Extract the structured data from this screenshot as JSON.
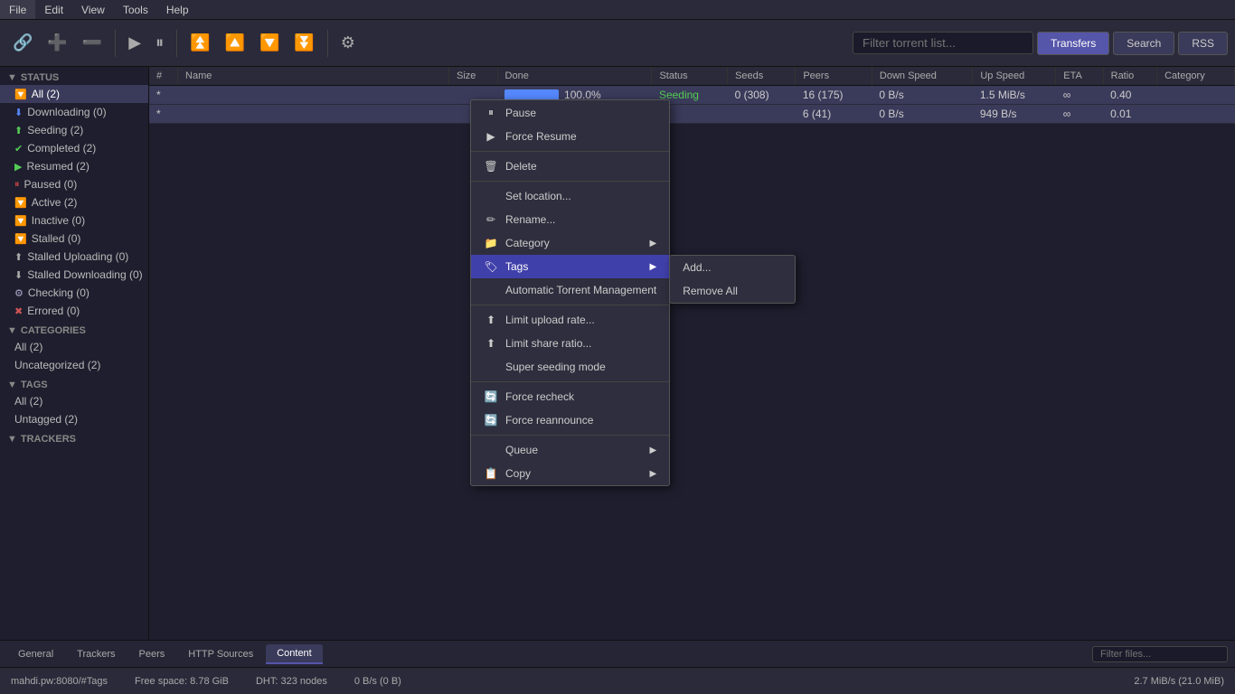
{
  "menubar": {
    "items": [
      "File",
      "Edit",
      "View",
      "Tools",
      "Help"
    ]
  },
  "toolbar": {
    "buttons": [
      {
        "name": "link-icon",
        "icon": "🔗"
      },
      {
        "name": "add-icon",
        "icon": "➕"
      },
      {
        "name": "remove-icon",
        "icon": "➖"
      },
      {
        "name": "resume-icon",
        "icon": "▶"
      },
      {
        "name": "pause-icon",
        "icon": "⏸"
      },
      {
        "name": "top-icon",
        "icon": "⏫"
      },
      {
        "name": "up-icon",
        "icon": "🔼"
      },
      {
        "name": "down-icon",
        "icon": "🔽"
      },
      {
        "name": "bottom-icon",
        "icon": "⏬"
      },
      {
        "name": "settings-icon",
        "icon": "⚙"
      }
    ],
    "filter_placeholder": "Filter torrent list...",
    "tabs": [
      "Transfers",
      "Search",
      "RSS"
    ]
  },
  "sidebar": {
    "status_header": "STATUS",
    "status_items": [
      {
        "label": "All (2)",
        "icon": "🔽",
        "active": true
      },
      {
        "label": "Downloading (0)",
        "icon": "⬇"
      },
      {
        "label": "Seeding (2)",
        "icon": "⬆"
      },
      {
        "label": "Completed (2)",
        "icon": "✔"
      },
      {
        "label": "Resumed (2)",
        "icon": "▶"
      },
      {
        "label": "Paused (0)",
        "icon": "⏸"
      },
      {
        "label": "Active (2)",
        "icon": "🔽"
      },
      {
        "label": "Inactive (0)",
        "icon": "🔽"
      },
      {
        "label": "Stalled (0)",
        "icon": "🔽"
      },
      {
        "label": "Stalled Uploading (0)",
        "icon": "⬆"
      },
      {
        "label": "Stalled Downloading (0)",
        "icon": "⬇"
      },
      {
        "label": "Checking (0)",
        "icon": "⚙"
      },
      {
        "label": "Errored (0)",
        "icon": "✖"
      }
    ],
    "categories_header": "CATEGORIES",
    "categories_items": [
      {
        "label": "All (2)"
      },
      {
        "label": "Uncategorized (2)"
      }
    ],
    "tags_header": "TAGS",
    "tags_items": [
      {
        "label": "All (2)"
      },
      {
        "label": "Untagged (2)"
      }
    ],
    "trackers_header": "TRACKERS"
  },
  "table": {
    "columns": [
      "#",
      "Name",
      "Size",
      "Done",
      "Status",
      "Seeds",
      "Peers",
      "Down Speed",
      "Up Speed",
      "ETA",
      "Ratio",
      "Category"
    ],
    "rows": [
      {
        "num": "*",
        "name": "",
        "size": "",
        "done": 100.0,
        "done_pct": "100.0%",
        "status": "Seeding",
        "seeds": "0 (308)",
        "peers": "16 (175)",
        "down_speed": "0 B/s",
        "up_speed": "1.5 MiB/s",
        "eta": "∞",
        "ratio": "0.40",
        "category": ""
      },
      {
        "num": "*",
        "name": "",
        "size": "",
        "done": 0,
        "done_pct": "",
        "status": "",
        "seeds": "",
        "peers": "6 (41)",
        "down_speed": "0 B/s",
        "up_speed": "949 B/s",
        "eta": "∞",
        "ratio": "0.01",
        "category": ""
      }
    ]
  },
  "context_menu": {
    "items": [
      {
        "id": "pause",
        "label": "Pause",
        "icon": "⏸",
        "has_sub": false
      },
      {
        "id": "force-resume",
        "label": "Force Resume",
        "icon": "▶",
        "has_sub": false
      },
      {
        "id": "sep1",
        "type": "sep"
      },
      {
        "id": "delete",
        "label": "Delete",
        "icon": "🗑",
        "has_sub": false
      },
      {
        "id": "sep2",
        "type": "sep"
      },
      {
        "id": "set-location",
        "label": "Set location...",
        "icon": "",
        "has_sub": false
      },
      {
        "id": "rename",
        "label": "Rename...",
        "icon": "✏",
        "has_sub": false
      },
      {
        "id": "category",
        "label": "Category",
        "icon": "📁",
        "has_sub": true
      },
      {
        "id": "tags",
        "label": "Tags",
        "icon": "🏷",
        "has_sub": true,
        "highlighted": true
      },
      {
        "id": "atm",
        "label": "Automatic Torrent Management",
        "icon": "",
        "has_sub": false
      },
      {
        "id": "sep3",
        "type": "sep"
      },
      {
        "id": "limit-upload",
        "label": "Limit upload rate...",
        "icon": "⬆",
        "has_sub": false
      },
      {
        "id": "limit-share",
        "label": "Limit share ratio...",
        "icon": "⬆",
        "has_sub": false
      },
      {
        "id": "super-seeding",
        "label": "Super seeding mode",
        "icon": "",
        "has_sub": false
      },
      {
        "id": "sep4",
        "type": "sep"
      },
      {
        "id": "force-recheck",
        "label": "Force recheck",
        "icon": "🔄",
        "has_sub": false
      },
      {
        "id": "force-reannounce",
        "label": "Force reannounce",
        "icon": "🔄",
        "has_sub": false
      },
      {
        "id": "sep5",
        "type": "sep"
      },
      {
        "id": "queue",
        "label": "Queue",
        "icon": "",
        "has_sub": true
      },
      {
        "id": "copy",
        "label": "Copy",
        "icon": "📋",
        "has_sub": true
      }
    ],
    "tags_submenu": [
      {
        "id": "add",
        "label": "Add..."
      },
      {
        "id": "remove-all",
        "label": "Remove All"
      }
    ]
  },
  "bottom_tabs": {
    "tabs": [
      "General",
      "Trackers",
      "Peers",
      "HTTP Sources",
      "Content"
    ],
    "active": "Content",
    "filter_placeholder": "Filter files..."
  },
  "status_bar": {
    "free_space": "Free space: 8.78 GiB",
    "dht": "DHT: 323 nodes",
    "speed": "0 B/s (0 B)",
    "global_speed": "2.7 MiB/s (21.0 MiB)",
    "address": "mahdi.pw:8080/#Tags"
  },
  "colors": {
    "accent": "#5555aa",
    "highlight": "#4040aa",
    "progress": "#5588ff",
    "seeding": "#55cc55",
    "error": "#cc5555"
  }
}
